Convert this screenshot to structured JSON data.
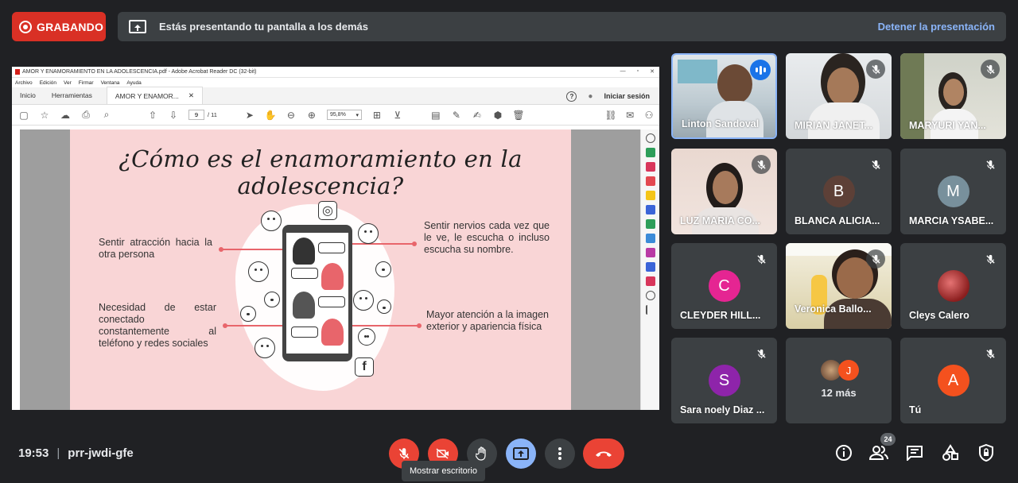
{
  "recording": {
    "label": "GRABANDO"
  },
  "banner": {
    "text": "Estás presentando tu pantalla a los demás",
    "stop_label": "Detener la presentación"
  },
  "acrobat": {
    "window_title": "AMOR Y ENAMORAMIENTO EN LA ADOLESCENCIA.pdf - Adobe Acrobat Reader DC (32-bit)",
    "menu": [
      "Archivo",
      "Edición",
      "Ver",
      "Firmar",
      "Ventana",
      "Ayuda"
    ],
    "tabs": {
      "home": "Inicio",
      "tools": "Herramientas",
      "doc": "AMOR Y ENAMOR..."
    },
    "signin": "Iniciar sesión",
    "page_current": "9",
    "page_total": "/ 11",
    "zoom": "95,8%"
  },
  "slide": {
    "title": "¿Cómo es el enamoramiento en la adolescencia?",
    "point1": "Sentir atracción hacia la otra persona",
    "point2": "Necesidad de estar conectado constantemente al teléfono y redes sociales",
    "point3": "Sentir nervios cada vez que le ve, le escucha o incluso escucha su nombre.",
    "point4": "Mayor atención a la imagen exterior y apariencia física"
  },
  "participants": [
    {
      "name": "Linton Sandoval",
      "status": "speaking"
    },
    {
      "name": "MIRIAN JANET...",
      "status": "muted"
    },
    {
      "name": "MARYURI YAN...",
      "status": "muted"
    },
    {
      "name": "LUZ MARIA CO...",
      "status": "muted"
    },
    {
      "name": "BLANCA ALICIA...",
      "initial": "B",
      "color": "#5d4037",
      "status": "muted"
    },
    {
      "name": "MARCIA YSABE...",
      "initial": "M",
      "color": "#78909c",
      "status": "muted"
    },
    {
      "name": "CLEYDER HILL...",
      "initial": "C",
      "color": "#e52592",
      "status": "muted"
    },
    {
      "name": "Veronica Ballo...",
      "status": "muted"
    },
    {
      "name": "Cleys Calero",
      "status": "muted"
    },
    {
      "name": "Sara noely Diaz ...",
      "initial": "S",
      "color": "#8e24aa",
      "status": "muted"
    },
    {
      "name": "12 más",
      "initial": "J",
      "color": "#f4511e"
    },
    {
      "name": "Tú",
      "initial": "A",
      "color": "#f4511e",
      "status": "muted"
    }
  ],
  "bottom": {
    "time": "19:53",
    "separator": "|",
    "meeting_code": "prr-jwdi-gfe",
    "tooltip": "Mostrar escritorio",
    "people_count": "24"
  },
  "colors": {
    "accent_red": "#ea4335",
    "accent_blue": "#8ab4f8",
    "bg": "#202124",
    "tile": "#3c4043"
  }
}
